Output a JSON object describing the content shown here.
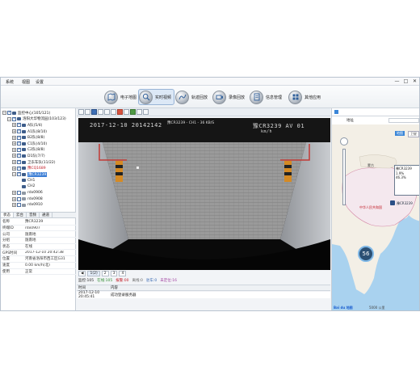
{
  "menu": {
    "system": "系统",
    "view": "视图",
    "settings": "设置"
  },
  "window_controls": {
    "minimize": "—",
    "maximize": "□",
    "close": "✕"
  },
  "toolbar": {
    "map": "电子地图",
    "realtime": "实时视频",
    "track": "轨迹回放",
    "recording": "录像回放",
    "info": "信息管理",
    "other": "其他应用"
  },
  "tree": {
    "root": "监控中心(105/121)",
    "group": "洛阳大华物流园(103/123)",
    "fleets": [
      "A队(5/4)",
      "A1队(8/10)",
      "B2队(8/8)",
      "C1队(4/10)",
      "C2队(8/8)",
      "D1队(7/7)",
      "卫东车队(11/22)"
    ],
    "vehicle_alert": "豫CQ1689",
    "vehicle_selected": "豫CR3239",
    "channels": [
      "CH1",
      "CH2"
    ],
    "other_devices": [
      "rdx0906",
      "rdx0908",
      "rdx0910",
      "rdx0912"
    ]
  },
  "left_tabs": [
    "状态",
    "云台",
    "音频",
    "通道"
  ],
  "props": [
    {
      "k": "名称",
      "v": "豫CR3239"
    },
    {
      "k": "终端ID",
      "v": "rdx0907"
    },
    {
      "k": "公司",
      "v": "陇南地"
    },
    {
      "k": "分组",
      "v": "陇南地"
    },
    {
      "k": "状态",
      "v": "在线"
    },
    {
      "k": "GPS时间",
      "v": "2017-12-10 20:42:38"
    },
    {
      "k": "位置",
      "v": "河南省洛阳市西工区G31"
    },
    {
      "k": "速度",
      "v": "0.00 km/h(北)"
    },
    {
      "k": "使用",
      "v": "正常"
    }
  ],
  "video": {
    "title": "豫CR3239 - CH1 - 36 KB/S",
    "osd_datetime": "2017-12-10 20142142",
    "osd_plate": "豫CR3239  AV 01",
    "osd_speed": "km/h"
  },
  "pages": {
    "prev": "◀",
    "items": [
      "1(2)",
      "2",
      "3",
      "4"
    ]
  },
  "stats": {
    "total": "监控:105",
    "online": "在线:105",
    "alarm": "报警:00",
    "offline": "离线:0",
    "stopped": "驻车:0",
    "unlocated": "未定位:16"
  },
  "log": {
    "headers": {
      "time": "时间",
      "content": "内容"
    },
    "rows": [
      {
        "time": "2017-12-10 20:45:41",
        "content": "成功登录服务器"
      }
    ]
  },
  "map": {
    "addr_label": "地址",
    "tab_map": "地图",
    "tab_sat": "卫星",
    "labels": {
      "country": "中华人民共和国",
      "mongolia": "蒙古",
      "vehicle": "豫CR3239",
      "speed_cluster": "56"
    },
    "popup": [
      "豫CR3239",
      "1.9%",
      "46.3%"
    ],
    "scale": "5000 公里",
    "logo": "Bai du 地图",
    "colors": {
      "sea": "#a9d2ef",
      "land": "#f3efe6",
      "china": "#f4e8ee"
    }
  }
}
